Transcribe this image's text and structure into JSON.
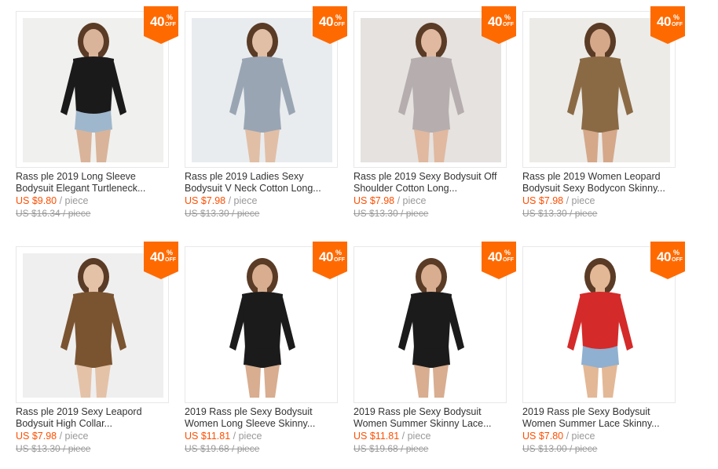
{
  "theme": {
    "accent": "#ff4e00",
    "badge": "#ff6a00"
  },
  "products": [
    {
      "discount": "40",
      "pct": "%",
      "off": "OFF",
      "title_l1": "Rass ple 2019 Long Sleeve",
      "title_l2": "Bodysuit Elegant Turtleneck...",
      "price": "US $9.80",
      "unit": "/ piece",
      "old": "US $16.34 / piece",
      "image": "black-turtleneck-bodysuit",
      "bg": "#f0f0ee",
      "top": "#1a1a1a",
      "bottom": "#9fb7cc",
      "skin": "#d9b49a"
    },
    {
      "discount": "40",
      "pct": "%",
      "off": "OFF",
      "title_l1": "Rass ple 2019 Ladies Sexy",
      "title_l2": "Bodysuit V Neck Cotton Long...",
      "price": "US $7.98",
      "unit": "/ piece",
      "old": "US $13.30 / piece",
      "image": "grey-vneck-bodysuit-collage",
      "bg": "#e9ecef",
      "top": "#9aa5b4",
      "bottom": "#9aa5b4",
      "skin": "#e1bfa6"
    },
    {
      "discount": "40",
      "pct": "%",
      "off": "OFF",
      "title_l1": "Rass ple 2019 Sexy Bodysuit Off",
      "title_l2": "Shoulder Cotton Long...",
      "price": "US $7.98",
      "unit": "/ piece",
      "old": "US $13.30 / piece",
      "image": "grey-off-shoulder-bodysuit",
      "bg": "#e5e2e0",
      "top": "#b6aeae",
      "bottom": "#b6aeae",
      "skin": "#e0b9a0"
    },
    {
      "discount": "40",
      "pct": "%",
      "off": "OFF",
      "title_l1": "Rass ple 2019 Women Leopard",
      "title_l2": "Bodysuit Sexy Bodycon Skinny...",
      "price": "US $7.98",
      "unit": "/ piece",
      "old": "US $13.30 / piece",
      "image": "leopard-bodysuit",
      "bg": "#ecebe8",
      "top": "#8a6a45",
      "bottom": "#8a6a45",
      "skin": "#d5a88a"
    },
    {
      "discount": "40",
      "pct": "%",
      "off": "OFF",
      "title_l1": "Rass ple 2019 Sexy Leapord",
      "title_l2": "Bodysuit High Collar...",
      "price": "US $7.98",
      "unit": "/ piece",
      "old": "US $13.30 / piece",
      "image": "leopard-high-collar-bodysuit",
      "bg": "#efefef",
      "top": "#7a5330",
      "bottom": "#7a5330",
      "skin": "#e4c2a8"
    },
    {
      "discount": "40",
      "pct": "%",
      "off": "OFF",
      "title_l1": "2019 Rass ple Sexy Bodysuit",
      "title_l2": "Women Long Sleeve Skinny...",
      "price": "US $11.81",
      "unit": "/ piece",
      "old": "US $19.68 / piece",
      "image": "black-lace-bodysuit-plus",
      "bg": "#ffffff",
      "top": "#1b1b1b",
      "bottom": "#1b1b1b",
      "skin": "#d8ad90"
    },
    {
      "discount": "40",
      "pct": "%",
      "off": "OFF",
      "title_l1": "2019 Rass ple Sexy Bodysuit",
      "title_l2": "Women Summer Skinny Lace...",
      "price": "US $11.81",
      "unit": "/ piece",
      "old": "US $19.68 / piece",
      "image": "black-lace-bodysuit-plus-2",
      "bg": "#ffffff",
      "top": "#1b1b1b",
      "bottom": "#1b1b1b",
      "skin": "#d8ad90"
    },
    {
      "discount": "40",
      "pct": "%",
      "off": "OFF",
      "title_l1": "2019 Rass ple Sexy Bodysuit",
      "title_l2": "Women Summer Lace Skinny...",
      "price": "US $7.80",
      "unit": "/ piece",
      "old": "US $13.00 / piece",
      "image": "red-lace-bodysuit",
      "bg": "#ffffff",
      "top": "#d42a2a",
      "bottom": "#8fb0d0",
      "skin": "#e3b896"
    }
  ]
}
